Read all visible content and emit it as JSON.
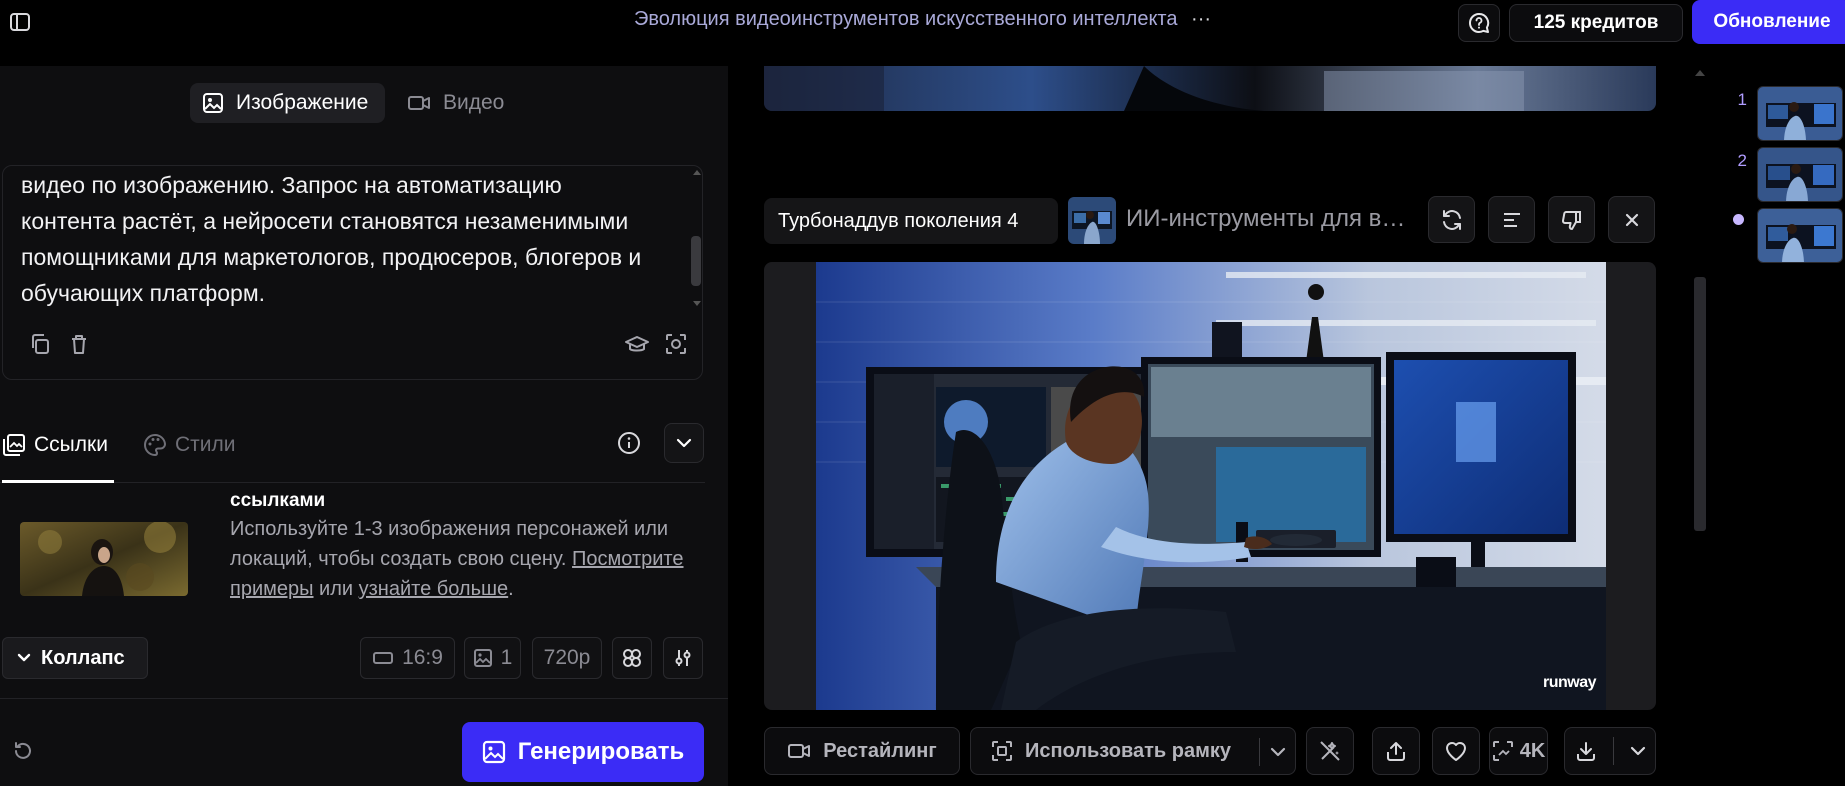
{
  "header": {
    "title": "Эволюция видеоинструментов искусственного интеллекта",
    "more_label": "···",
    "credits": "125 кредитов",
    "upgrade": "Обновление"
  },
  "mode_tabs": [
    {
      "label": "Изображение",
      "active": true
    },
    {
      "label": "Видео",
      "active": false
    }
  ],
  "prompt": {
    "text": "функции — это автоматическое создание видео по тексту и видео по изображению. Запрос на автоматизацию контента растёт, а нейросети становятся незаменимыми помощниками для маркетологов, продюсеров, блогеров и обучающих платформ."
  },
  "section_tabs": [
    {
      "label": "Ссылки",
      "active": true
    },
    {
      "label": "Стили",
      "active": false
    }
  ],
  "references": {
    "heading": "ссылками",
    "desc_text": "Используйте 1-3 изображения персонажей или локаций, чтобы создать свою сцену. ",
    "link_examples": "Посмотрите примеры",
    "or": " или ",
    "link_learn": "узнайте больше",
    "period": "."
  },
  "options": {
    "collapse": "Коллапс",
    "aspect": "16:9",
    "count": "1",
    "resolution": "720p"
  },
  "generate_label": "Генерировать",
  "generation": {
    "model": "Турбонаддув поколения 4",
    "title": "ИИ-инструменты для видеомонтажа",
    "watermark": "runway"
  },
  "actions": {
    "restyle": "Рестайлинг",
    "use_frame": "Использовать рамку",
    "upscale": "4K"
  },
  "history": {
    "numbers": [
      "1",
      "2"
    ]
  },
  "colors": {
    "accent": "#3b2cf6",
    "title": "#a9a9d8",
    "history_number": "#b09cff"
  }
}
